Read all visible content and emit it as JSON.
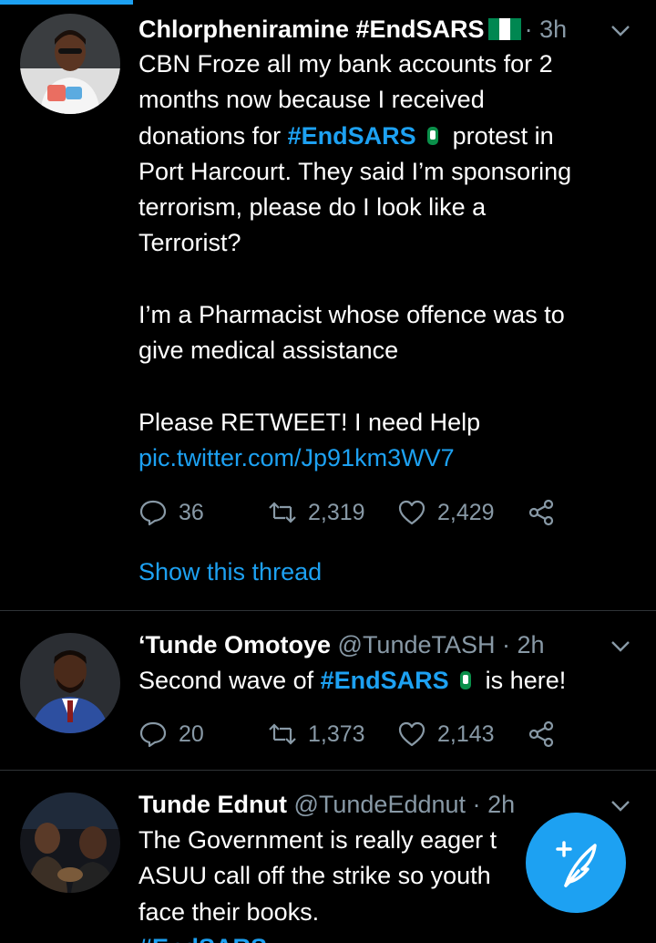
{
  "colors": {
    "accent": "#1da1f2",
    "muted": "#8899a6",
    "background": "#000000"
  },
  "tweets": [
    {
      "name": "Chlorpheniramine #EndSARS",
      "handle": "",
      "time": "3h",
      "dot": "·",
      "lines_a": [
        "CBN Froze all my bank accounts for 2",
        "months now because I received"
      ],
      "line_c_pre": "donations for ",
      "hashtag": "#EndSARS",
      "line_c_post": "protest in",
      "lines_b": [
        "Port Harcourt. They said I’m sponsoring",
        "terrorism, please do I look like a",
        "Terrorist?"
      ],
      "lines_p2": [
        "I’m a Pharmacist whose offence was to",
        "give medical assistance"
      ],
      "lines_p3": [
        "Please RETWEET! I need Help"
      ],
      "link": "pic.twitter.com/Jp91km3WV7",
      "replies": "36",
      "retweets": "2,319",
      "likes": "2,429",
      "thread_label": "Show this thread"
    },
    {
      "name": "‘Tunde Omotoye",
      "handle": "@TundeTASH",
      "dot": "·",
      "time": "2h",
      "pre": "Second wave of ",
      "hashtag": "#EndSARS",
      "post": "is here!",
      "replies": "20",
      "retweets": "1,373",
      "likes": "2,143"
    },
    {
      "name": "Tunde Ednut",
      "handle": "@TundeEddnut",
      "dot": "·",
      "time": "2h",
      "lines": [
        "The Government is really eager t",
        "ASUU call off the strike so youth",
        "face their books."
      ],
      "hashtag": "#EndSARS"
    }
  ],
  "icons": {
    "reply": "reply-icon",
    "retweet": "retweet-icon",
    "like": "heart-icon",
    "share": "share-icon",
    "compose": "compose-tweet-icon",
    "caret": "chevron-down-icon",
    "flag": "nigeria-flag-icon",
    "hashflag": "endsars-fist-icon"
  }
}
